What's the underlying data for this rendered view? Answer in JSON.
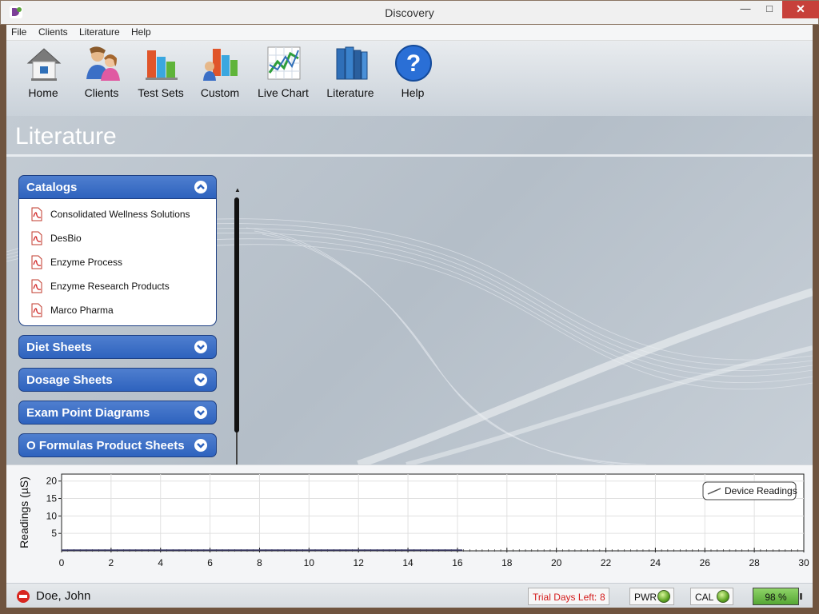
{
  "window": {
    "title": "Discovery"
  },
  "menu": [
    "File",
    "Clients",
    "Literature",
    "Help"
  ],
  "toolbar": {
    "items": [
      {
        "label": "Home",
        "icon": "home-icon"
      },
      {
        "label": "Clients",
        "icon": "clients-icon"
      },
      {
        "label": "Test Sets",
        "icon": "test-sets-icon"
      },
      {
        "label": "Custom",
        "icon": "custom-icon"
      },
      {
        "label": "Live Chart",
        "icon": "live-chart-icon"
      },
      {
        "label": "Literature",
        "icon": "literature-icon"
      },
      {
        "label": "Help",
        "icon": "help-icon"
      }
    ]
  },
  "page": {
    "title": "Literature"
  },
  "accordion": {
    "panels": [
      {
        "title": "Catalogs",
        "expanded": true,
        "items": [
          "Consolidated Wellness Solutions",
          "DesBio",
          "Enzyme Process",
          "Enzyme Research Products",
          "Marco Pharma"
        ]
      },
      {
        "title": "Diet Sheets",
        "expanded": false
      },
      {
        "title": "Dosage Sheets",
        "expanded": false
      },
      {
        "title": "Exam Point Diagrams",
        "expanded": false
      },
      {
        "title": "O Formulas Product Sheets",
        "expanded": false
      }
    ]
  },
  "chart_data": {
    "type": "line",
    "ylabel": "Readings (µS)",
    "xlabel": "",
    "xlim": [
      0,
      30
    ],
    "ylim": [
      0,
      22
    ],
    "x_ticks": [
      0,
      2,
      4,
      6,
      8,
      10,
      12,
      14,
      16,
      18,
      20,
      22,
      24,
      26,
      28,
      30
    ],
    "y_ticks": [
      5,
      10,
      15,
      20
    ],
    "grid": true,
    "legend_position": "top-right",
    "series": [
      {
        "name": "Device Readings",
        "x": [
          0,
          16.2
        ],
        "y": [
          0,
          0
        ]
      }
    ]
  },
  "status": {
    "user": "Doe, John",
    "trial_label": "Trial Days Left:",
    "trial_days": "8",
    "pwr_label": "PWR",
    "cal_label": "CAL",
    "battery": "98 %"
  },
  "colors": {
    "accordion_header": "#3a6cc4",
    "trial_text": "#d31b1b",
    "led_green": "#5fa524",
    "close_button": "#c7403a"
  }
}
